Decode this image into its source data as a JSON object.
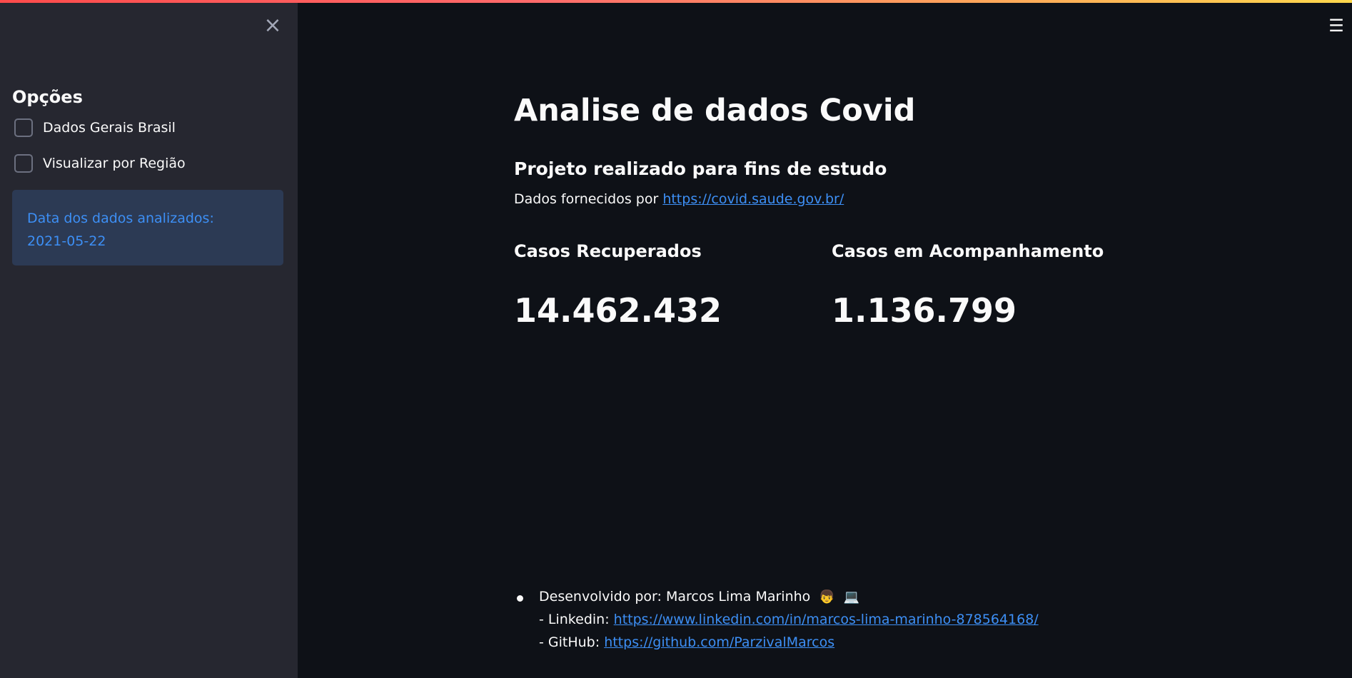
{
  "sidebar": {
    "close_icon": "×",
    "title": "Opções",
    "checkboxes": [
      {
        "label": "Dados Gerais Brasil",
        "checked": false
      },
      {
        "label": "Visualizar por Região",
        "checked": false
      }
    ],
    "info": {
      "line1": "Data dos dados analizados:",
      "line2": "2021-05-22"
    }
  },
  "header": {
    "menu_icon": "☰"
  },
  "main": {
    "title": "Analise de dados Covid",
    "subtitle": "Projeto realizado para fins de estudo",
    "source_prefix": "Dados fornecidos por",
    "source_link": "https://covid.saude.gov.br/",
    "metrics": [
      {
        "label": "Casos Recuperados",
        "value": "14.462.432"
      },
      {
        "label": "Casos em Acompanhamento",
        "value": "1.136.799"
      }
    ],
    "credits": {
      "developer_prefix": "Desenvolvido por: Marcos Lima Marinho",
      "emoji_1": "👦",
      "emoji_2": "💻",
      "linkedin_prefix": "- Linkedin:",
      "linkedin_url": "https://www.linkedin.com/in/marcos-lima-marinho-878564168/",
      "github_prefix": "- GitHub:",
      "github_url": "https://github.com/ParzivalMarcos"
    }
  },
  "colors": {
    "background": "#0e1117",
    "sidebar": "#262730",
    "link": "#3d8ff5",
    "info_box": "#2c3a54"
  }
}
